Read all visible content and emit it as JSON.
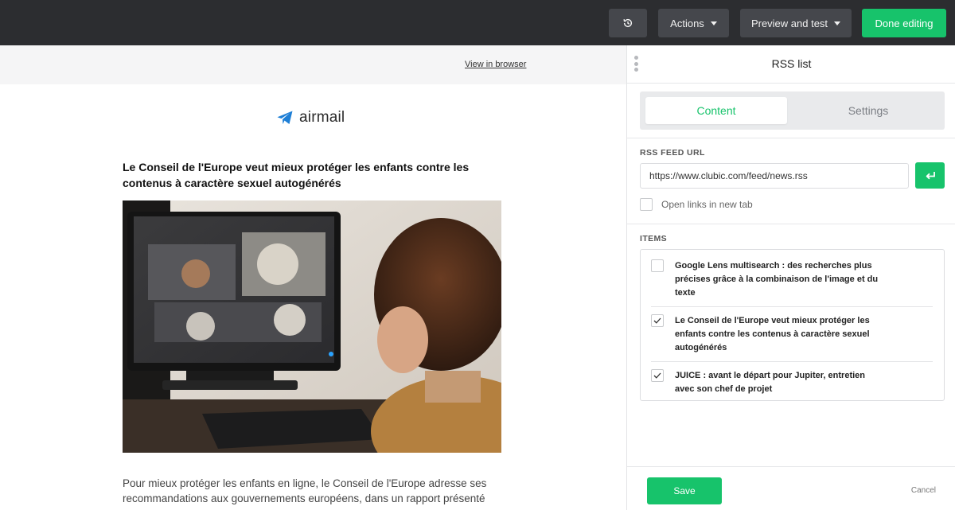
{
  "topbar": {
    "history_icon": "history-icon",
    "actions_label": "Actions",
    "preview_label": "Preview and test",
    "done_label": "Done editing"
  },
  "preview": {
    "view_in_browser": "View in browser",
    "logo_text": "airmail",
    "logo_icon": "paper-plane-icon",
    "article_title": "Le Conseil de l'Europe veut mieux protéger les enfants contre les contenus à caractère sexuel autogénérés",
    "article_excerpt": "Pour mieux protéger les enfants en ligne, le Conseil de l'Europe adresse ses recommandations aux gouvernements européens, dans un rapport présenté"
  },
  "panel": {
    "title": "RSS list",
    "tabs": [
      {
        "label": "Content",
        "active": true
      },
      {
        "label": "Settings",
        "active": false
      }
    ],
    "rss_label": "RSS FEED URL",
    "rss_url": "https://www.clubic.com/feed/news.rss",
    "submit_icon": "enter-icon",
    "open_new_tab_label": "Open links in new tab",
    "open_new_tab_checked": false,
    "items_label": "ITEMS",
    "items": [
      {
        "title": "Google Lens multisearch : des recherches plus précises grâce à la combinaison de l'image et du texte",
        "checked": false
      },
      {
        "title": "Le Conseil de l'Europe veut mieux protéger les enfants contre les contenus à caractère sexuel autogénérés",
        "checked": true
      },
      {
        "title": "JUICE : avant le départ pour Jupiter, entretien avec son chef de projet",
        "checked": true
      }
    ],
    "save_label": "Save",
    "cancel_label": "Cancel"
  },
  "colors": {
    "topbar_bg": "#2c2d30",
    "button_bg": "#45474c",
    "accent_green": "#17c36b",
    "logo_blue": "#1e7fd6"
  }
}
